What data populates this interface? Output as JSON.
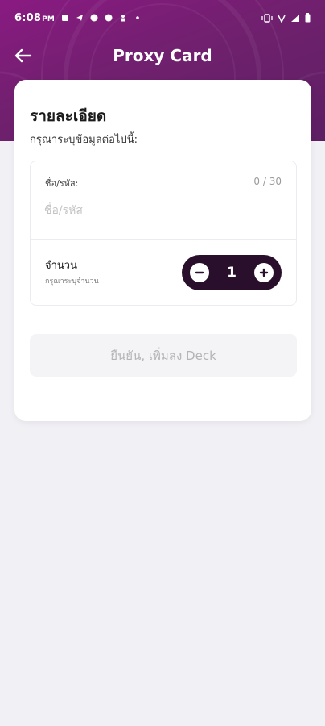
{
  "status_bar": {
    "time": "6:08",
    "ampm": "PM"
  },
  "nav": {
    "title": "Proxy Card"
  },
  "card": {
    "title": "รายละเอียด",
    "subtitle": "กรุณาระบุข้อมูลต่อไปนี้:"
  },
  "name_field": {
    "label": "ชื่อ/รหัส:",
    "counter": "0 / 30",
    "value": "",
    "placeholder": "ชื่อ/รหัส"
  },
  "quantity": {
    "label": "จำนวน",
    "hint": "กรุณาระบุจำนวน",
    "value": "1"
  },
  "confirm_button": {
    "label": "ยืนยัน, เพิ่มลง Deck",
    "enabled": false
  },
  "colors": {
    "header_gradient_start": "#8a1a82",
    "header_gradient_end": "#5d1f63",
    "stepper_bg": "#2a0f2c",
    "page_bg": "#f1f0f5"
  },
  "icons": {
    "back": "arrow-left-icon",
    "minus": "minus-icon",
    "plus": "plus-icon"
  }
}
